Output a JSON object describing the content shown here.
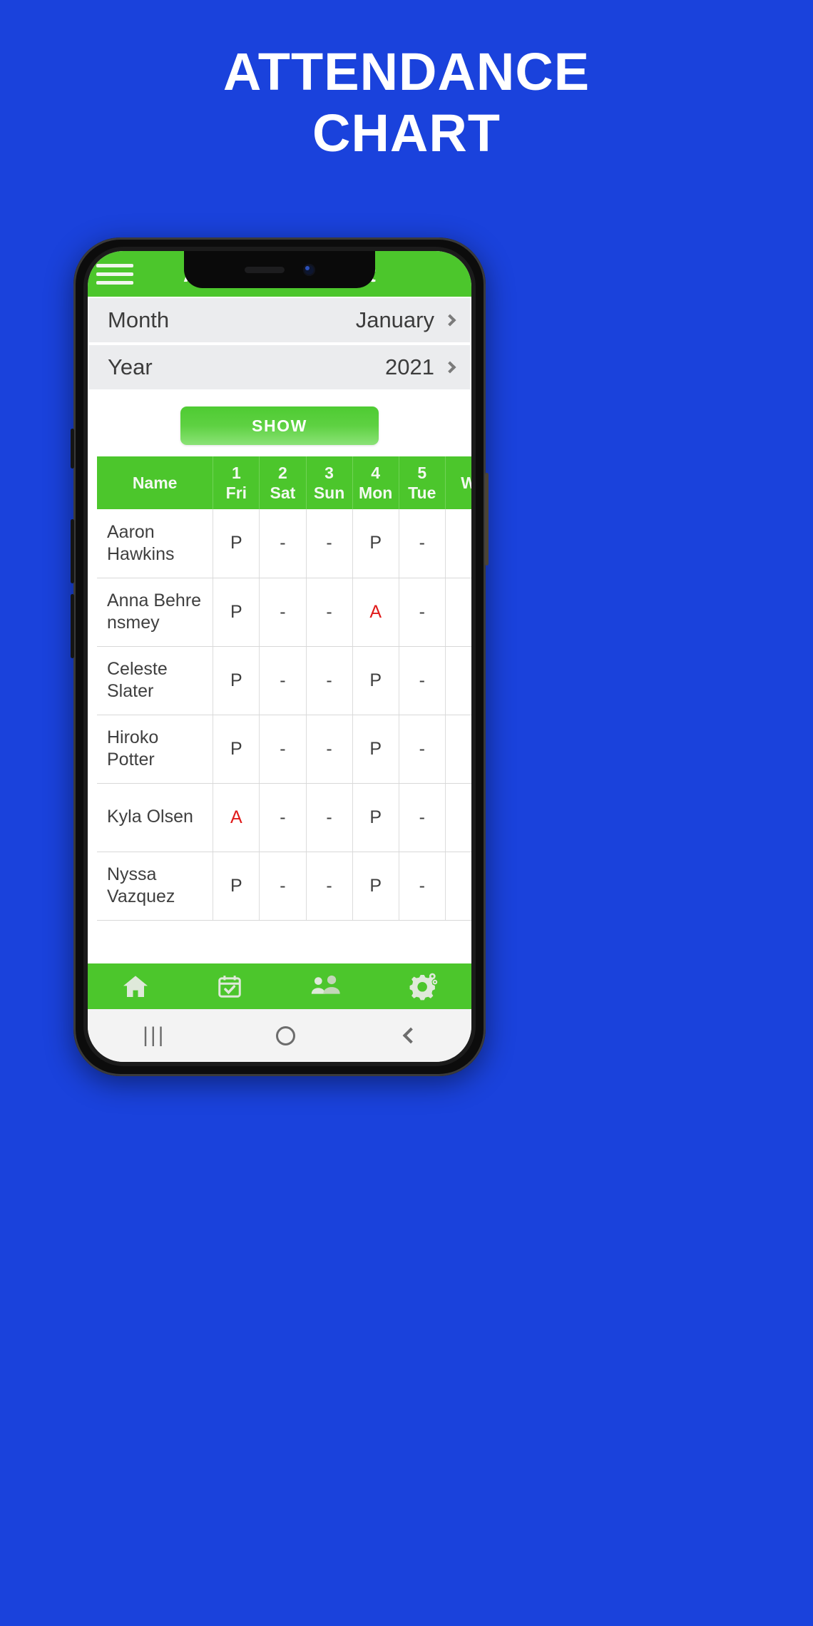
{
  "poster": {
    "title_line1": "ATTENDANCE",
    "title_line2": "CHART",
    "background_color": "#1A42DC",
    "title_color": "#FFFFFF"
  },
  "theme": {
    "brand_green": "#4CC62C",
    "absent_red": "#E01B1B",
    "row_gray": "#EBECEE"
  },
  "app": {
    "appbar": {
      "menu_icon": "hamburger-menu-icon",
      "title": "Attendance Chart"
    },
    "selectors": [
      {
        "label": "Month",
        "value": "January",
        "chevron_icon": "chevron-right-icon"
      },
      {
        "label": "Year",
        "value": "2021",
        "chevron_icon": "chevron-right-icon"
      }
    ],
    "show_button": {
      "label": "SHOW"
    },
    "table": {
      "name_header": "Name",
      "day_headers": [
        {
          "day": "1",
          "weekday": "Fri"
        },
        {
          "day": "2",
          "weekday": "Sat"
        },
        {
          "day": "3",
          "weekday": "Sun"
        },
        {
          "day": "4",
          "weekday": "Mon"
        },
        {
          "day": "5",
          "weekday": "Tue"
        },
        {
          "day": "",
          "weekday": "W"
        }
      ],
      "rows": [
        {
          "name": "Aaron Hawkins",
          "marks": [
            "P",
            "-",
            "-",
            "P",
            "-",
            ""
          ]
        },
        {
          "name": "Anna Behre nsmey",
          "marks": [
            "P",
            "-",
            "-",
            "A",
            "-",
            ""
          ]
        },
        {
          "name": "Celeste Slater",
          "marks": [
            "P",
            "-",
            "-",
            "P",
            "-",
            ""
          ]
        },
        {
          "name": "Hiroko Potter",
          "marks": [
            "P",
            "-",
            "-",
            "P",
            "-",
            ""
          ]
        },
        {
          "name": "Kyla Olsen",
          "marks": [
            "A",
            "-",
            "-",
            "P",
            "-",
            ""
          ]
        },
        {
          "name": "Nyssa Vazquez",
          "marks": [
            "P",
            "-",
            "-",
            "P",
            "-",
            ""
          ]
        }
      ],
      "mark_legend": {
        "present": "P",
        "absent": "A",
        "none": "-"
      }
    },
    "bottom_nav": [
      {
        "icon": "home-icon"
      },
      {
        "icon": "calendar-check-icon"
      },
      {
        "icon": "people-group-icon"
      },
      {
        "icon": "gears-settings-icon"
      }
    ],
    "system_nav": [
      {
        "icon": "recents-icon",
        "glyph": "|||"
      },
      {
        "icon": "home-circle-icon"
      },
      {
        "icon": "back-chevron-icon"
      }
    ]
  }
}
